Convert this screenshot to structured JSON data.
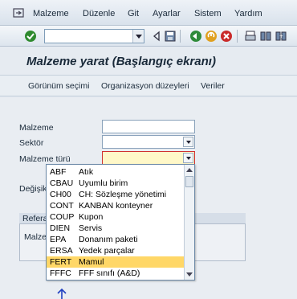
{
  "menu": {
    "items": [
      "Malzeme",
      "Düzenle",
      "Git",
      "Ayarlar",
      "Sistem",
      "Yardım"
    ]
  },
  "toolbar": {
    "command_value": ""
  },
  "page": {
    "title": "Malzeme yarat (Başlangıç ekranı)"
  },
  "appbar": {
    "buttons": [
      "Görünüm seçimi",
      "Organizasyon düzeyleri",
      "Veriler"
    ]
  },
  "form": {
    "malzeme_label": "Malzeme",
    "malzeme_value": "",
    "sektor_label": "Sektör",
    "sektor_value": "",
    "malzeme_turu_label": "Malzeme türü",
    "malzeme_turu_value": "",
    "change_label_partial": "Değişik",
    "ref_tab_partial": "Refera",
    "ref_malzeme_partial": "Malzem"
  },
  "dropdown": {
    "selected_code": "FERT",
    "options": [
      {
        "code": "ABF",
        "desc": "Atık"
      },
      {
        "code": "CBAU",
        "desc": "Uyumlu birim"
      },
      {
        "code": "CH00",
        "desc": "CH: Sözleşme yönetimi"
      },
      {
        "code": "CONT",
        "desc": "KANBAN konteyner"
      },
      {
        "code": "COUP",
        "desc": "Kupon"
      },
      {
        "code": "DIEN",
        "desc": "Servis"
      },
      {
        "code": "EPA",
        "desc": "Donanım paketi"
      },
      {
        "code": "ERSA",
        "desc": "Yedek parçalar"
      },
      {
        "code": "FERT",
        "desc": "Mamul"
      },
      {
        "code": "FFFC",
        "desc": "FFF sınıfı (A&D)"
      }
    ]
  },
  "colors": {
    "selected_row": "#ffd767",
    "required_border": "#d03030",
    "title_text": "#1a2a3a"
  }
}
